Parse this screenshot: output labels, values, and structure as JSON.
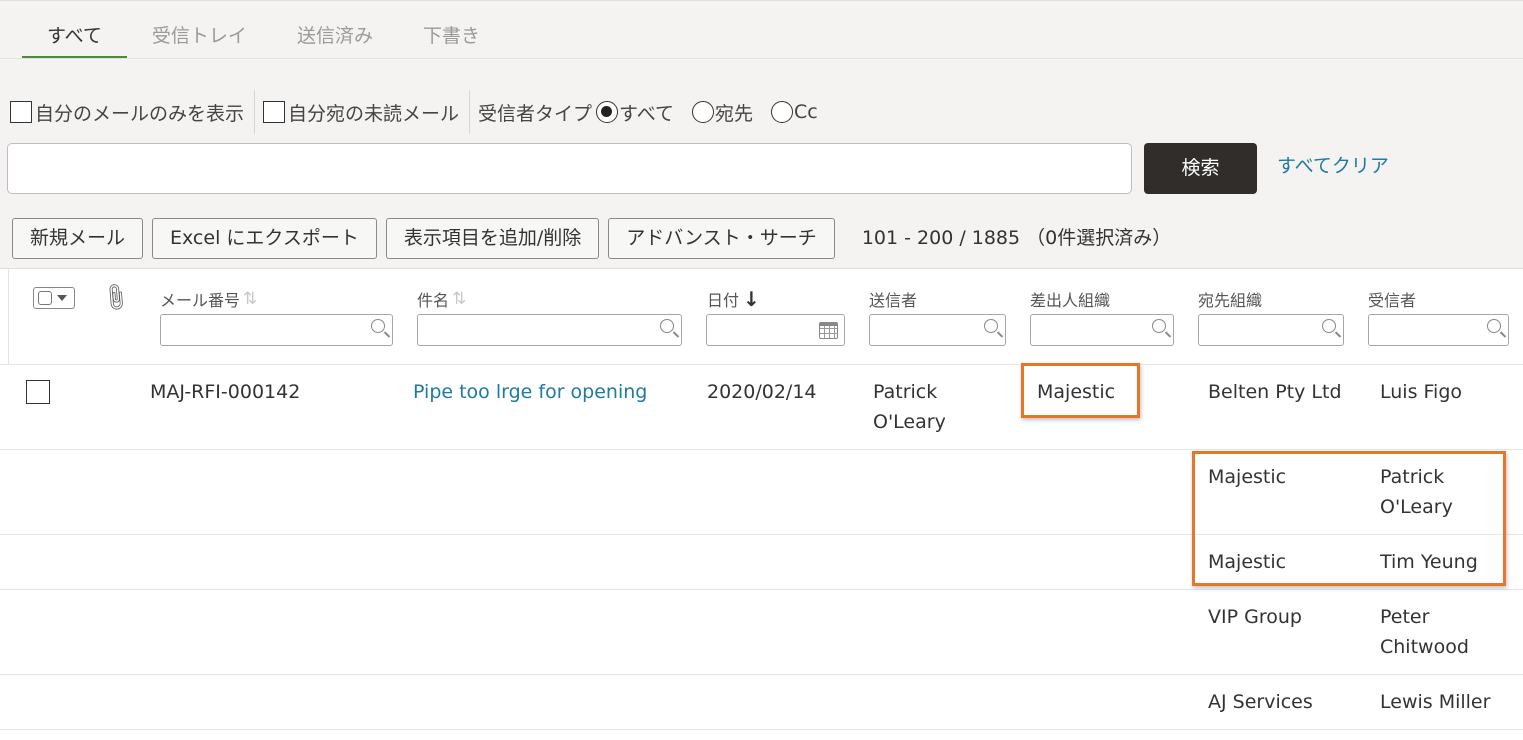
{
  "tabs": [
    {
      "label": "すべて",
      "active": true
    },
    {
      "label": "受信トレイ",
      "active": false
    },
    {
      "label": "送信済み",
      "active": false
    },
    {
      "label": "下書き",
      "active": false
    }
  ],
  "filters": {
    "only_mine_label": "自分のメールのみを表示",
    "only_mine_checked": false,
    "unread_to_me_label": "自分宛の未読メール",
    "unread_to_me_checked": false,
    "recipient_type_label": "受信者タイプ",
    "recipient_type_options": [
      "すべて",
      "宛先",
      "Cc"
    ],
    "recipient_type_selected": "すべて"
  },
  "search": {
    "value": "",
    "button_label": "検索",
    "clear_label": "すべてクリア"
  },
  "actions": {
    "new_mail": "新規メール",
    "export_excel": "Excel にエクスポート",
    "columns": "表示項目を追加/削除",
    "advanced_search": "アドバンスト・サーチ",
    "count_text": "101 - 200 / 1885 （0件選択済み）"
  },
  "columns": {
    "number": "メール番号",
    "subject": "件名",
    "date": "日付",
    "sender": "送信者",
    "sender_org": "差出人組織",
    "to_org": "宛先組織",
    "recipient": "受信者"
  },
  "rows": [
    {
      "number": "MAJ-RFI-000142",
      "subject": "Pipe too lrge for opening",
      "date": "2020/02/14",
      "sender_line1": "Patrick",
      "sender_line2": "O'Leary",
      "sender_org": "Majestic",
      "recipients": [
        {
          "org": "Belten Pty Ltd",
          "name_line1": "Luis Figo",
          "name_line2": ""
        },
        {
          "org": "Majestic",
          "name_line1": "Patrick",
          "name_line2": "O'Leary"
        },
        {
          "org": "Majestic",
          "name_line1": "Tim Yeung",
          "name_line2": ""
        },
        {
          "org": "VIP Group",
          "name_line1": "Peter",
          "name_line2": "Chitwood"
        },
        {
          "org": "AJ Services",
          "name_line1": "Lewis Miller",
          "name_line2": ""
        }
      ]
    }
  ],
  "colors": {
    "accent": "#4f8a3c",
    "link": "#1f7aa0",
    "highlight": "#e8762a",
    "search_button": "#312d2a"
  }
}
